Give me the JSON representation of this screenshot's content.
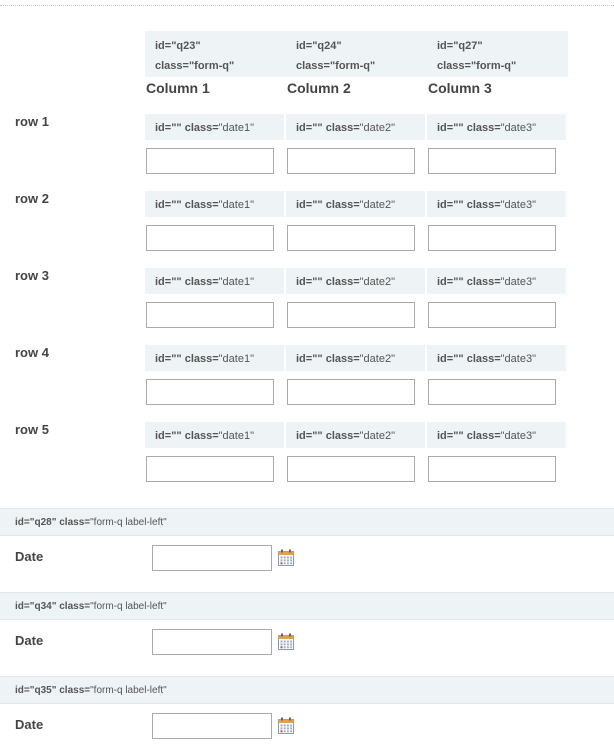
{
  "matrix": {
    "columns": [
      {
        "id_line": "id=\"q23\"",
        "class_line": "class=\"form-q\"",
        "title": "Column 1"
      },
      {
        "id_line": "id=\"q24\"",
        "class_line": "class=\"form-q\"",
        "title": "Column 2"
      },
      {
        "id_line": "id=\"q27\"",
        "class_line": "class=\"form-q\"",
        "title": "Column 3"
      }
    ],
    "rows": [
      {
        "label": "row 1",
        "cells": [
          {
            "id": "id=\"\"",
            "cls_label": "class=",
            "cls_val": "\"date1\"",
            "value": ""
          },
          {
            "id": "id=\"\"",
            "cls_label": "class=",
            "cls_val": "\"date2\"",
            "value": ""
          },
          {
            "id": "id=\"\"",
            "cls_label": "class=",
            "cls_val": "\"date3\"",
            "value": ""
          }
        ]
      },
      {
        "label": "row 2",
        "cells": [
          {
            "id": "id=\"\"",
            "cls_label": "class=",
            "cls_val": "\"date1\"",
            "value": ""
          },
          {
            "id": "id=\"\"",
            "cls_label": "class=",
            "cls_val": "\"date2\"",
            "value": ""
          },
          {
            "id": "id=\"\"",
            "cls_label": "class=",
            "cls_val": "\"date3\"",
            "value": ""
          }
        ]
      },
      {
        "label": "row 3",
        "cells": [
          {
            "id": "id=\"\"",
            "cls_label": "class=",
            "cls_val": "\"date1\"",
            "value": ""
          },
          {
            "id": "id=\"\"",
            "cls_label": "class=",
            "cls_val": "\"date2\"",
            "value": ""
          },
          {
            "id": "id=\"\"",
            "cls_label": "class=",
            "cls_val": "\"date3\"",
            "value": ""
          }
        ]
      },
      {
        "label": "row 4",
        "cells": [
          {
            "id": "id=\"\"",
            "cls_label": "class=",
            "cls_val": "\"date1\"",
            "value": ""
          },
          {
            "id": "id=\"\"",
            "cls_label": "class=",
            "cls_val": "\"date2\"",
            "value": ""
          },
          {
            "id": "id=\"\"",
            "cls_label": "class=",
            "cls_val": "\"date3\"",
            "value": ""
          }
        ]
      },
      {
        "label": "row 5",
        "cells": [
          {
            "id": "id=\"\"",
            "cls_label": "class=",
            "cls_val": "\"date1\"",
            "value": ""
          },
          {
            "id": "id=\"\"",
            "cls_label": "class=",
            "cls_val": "\"date2\"",
            "value": ""
          },
          {
            "id": "id=\"\"",
            "cls_label": "class=",
            "cls_val": "\"date3\"",
            "value": ""
          }
        ]
      }
    ]
  },
  "date_questions": [
    {
      "id_text": "id=\"q28\"",
      "cls_label": "class=",
      "cls_val": "\"form-q label-left\"",
      "label": "Date",
      "value": "",
      "icon": "calendar-icon"
    },
    {
      "id_text": "id=\"q34\"",
      "cls_label": "class=",
      "cls_val": "\"form-q label-left\"",
      "label": "Date",
      "value": "",
      "icon": "calendar-icon"
    },
    {
      "id_text": "id=\"q35\"",
      "cls_label": "class=",
      "cls_val": "\"form-q label-left\"",
      "label": "Date",
      "value": "",
      "icon": "calendar-icon"
    }
  ]
}
